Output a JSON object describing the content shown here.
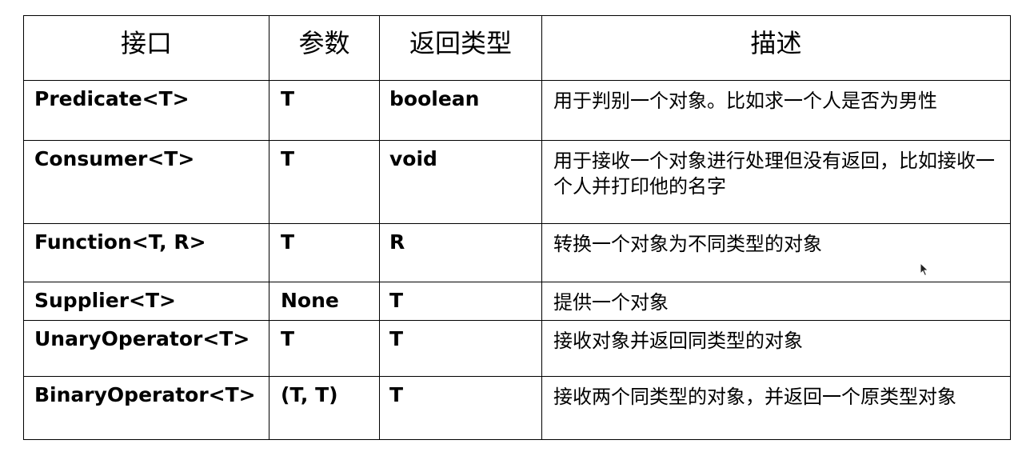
{
  "table": {
    "headers": [
      "接口",
      "参数",
      "返回类型",
      "描述"
    ],
    "rows": [
      {
        "interface": "Predicate<T>",
        "param": "T",
        "return_type": "boolean",
        "description": "用于判别一个对象。比如求一个人是否为男性"
      },
      {
        "interface": "Consumer<T>",
        "param": "T",
        "return_type": "void",
        "description": "用于接收一个对象进行处理但没有返回，比如接收一个人并打印他的名字"
      },
      {
        "interface": "Function<T, R>",
        "param": "T",
        "return_type": "R",
        "description": "转换一个对象为不同类型的对象"
      },
      {
        "interface": "Supplier<T>",
        "param": "None",
        "return_type": "T",
        "description": "提供一个对象"
      },
      {
        "interface": "UnaryOperator<T>",
        "param": "T",
        "return_type": "T",
        "description": "接收对象并返回同类型的对象"
      },
      {
        "interface": "BinaryOperator<T>",
        "param": "(T, T)",
        "return_type": "T",
        "description": "接收两个同类型的对象，并返回一个原类型对象"
      }
    ]
  }
}
